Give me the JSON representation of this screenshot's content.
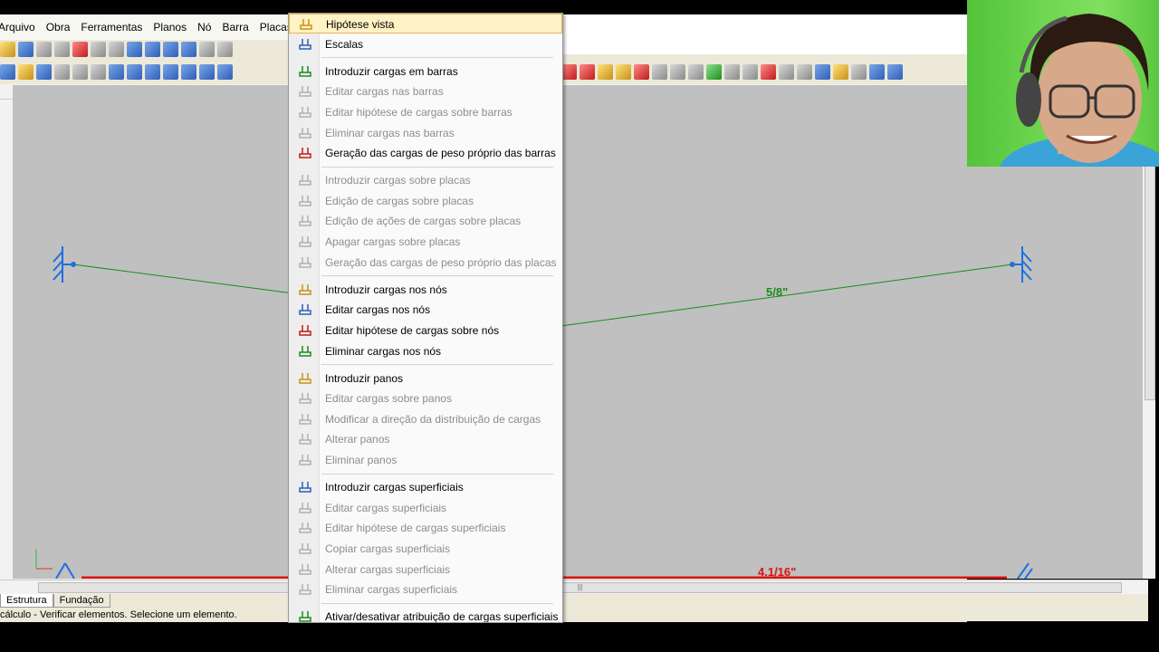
{
  "menubar": {
    "items": [
      "Arquivo",
      "Obra",
      "Ferramentas",
      "Planos",
      "Nó",
      "Barra",
      "Placas"
    ]
  },
  "canvas": {
    "labels": {
      "top_bar": "5/8\"",
      "bottom_bar": "4.1/16\""
    }
  },
  "tabs": [
    "Estrutura",
    "Fundação"
  ],
  "status": "cálculo - Verificar elementos.  Selecione um elemento.",
  "colors": {
    "top_bar": "#1a8c1a",
    "bottom_bar": "#e01010",
    "support": "#1e6fe0",
    "highlight": "#fff2c4"
  },
  "menu": {
    "items": [
      {
        "label": "Hipótese vista",
        "enabled": true,
        "highlighted": true,
        "icon": "hypothesis-icon"
      },
      {
        "label": "Escalas",
        "enabled": true,
        "icon": "scale-icon"
      },
      {
        "sep": true
      },
      {
        "label": "Introduzir cargas em barras",
        "enabled": true,
        "icon": "bar-load-add-icon"
      },
      {
        "label": "Editar cargas nas barras",
        "enabled": false,
        "icon": "bar-load-edit-icon"
      },
      {
        "label": "Editar hipótese de cargas sobre barras",
        "enabled": false,
        "icon": "bar-hypothesis-icon"
      },
      {
        "label": "Eliminar cargas nas barras",
        "enabled": false,
        "icon": "bar-load-delete-icon"
      },
      {
        "label": "Geração das cargas de peso próprio das barras",
        "enabled": true,
        "icon": "self-weight-icon"
      },
      {
        "sep": true
      },
      {
        "label": "Introduzir cargas sobre placas",
        "enabled": false,
        "icon": "plate-load-add-icon"
      },
      {
        "label": "Edição de cargas sobre placas",
        "enabled": false,
        "icon": "plate-load-edit-icon"
      },
      {
        "label": "Edição de ações de cargas sobre placas",
        "enabled": false,
        "icon": "plate-action-icon"
      },
      {
        "label": "Apagar cargas sobre placas",
        "enabled": false,
        "icon": "plate-load-delete-icon"
      },
      {
        "label": "Geração das cargas de peso próprio das placas",
        "enabled": false,
        "icon": "plate-weight-icon"
      },
      {
        "sep": true
      },
      {
        "label": "Introduzir cargas nos nós",
        "enabled": true,
        "icon": "node-load-add-icon"
      },
      {
        "label": "Editar cargas nos nós",
        "enabled": true,
        "icon": "node-load-edit-icon"
      },
      {
        "label": "Editar hipótese de cargas sobre nós",
        "enabled": true,
        "icon": "node-hypothesis-icon"
      },
      {
        "label": "Eliminar cargas nos nós",
        "enabled": true,
        "icon": "node-load-delete-icon"
      },
      {
        "sep": true
      },
      {
        "label": "Introduzir panos",
        "enabled": true,
        "icon": "panel-add-icon"
      },
      {
        "label": "Editar cargas sobre panos",
        "enabled": false,
        "icon": "panel-edit-icon"
      },
      {
        "label": "Modificar a direção da distribuição de cargas",
        "enabled": false,
        "icon": "panel-direction-icon"
      },
      {
        "label": "Alterar panos",
        "enabled": false,
        "icon": "panel-modify-icon"
      },
      {
        "label": "Eliminar panos",
        "enabled": false,
        "icon": "panel-delete-icon"
      },
      {
        "sep": true
      },
      {
        "label": "Introduzir cargas superficiais",
        "enabled": true,
        "icon": "surface-load-add-icon"
      },
      {
        "label": "Editar cargas superficiais",
        "enabled": false,
        "icon": "surface-load-edit-icon"
      },
      {
        "label": "Editar hipótese de cargas superficiais",
        "enabled": false,
        "icon": "surface-hypothesis-icon"
      },
      {
        "label": "Copiar cargas superficiais",
        "enabled": false,
        "icon": "surface-copy-icon"
      },
      {
        "label": "Alterar cargas superficiais",
        "enabled": false,
        "icon": "surface-modify-icon"
      },
      {
        "label": "Eliminar cargas superficiais",
        "enabled": false,
        "icon": "surface-delete-icon"
      },
      {
        "sep": true
      },
      {
        "label": "Ativar/desativar atribuição de cargas superficiais",
        "enabled": true,
        "icon": "surface-toggle-icon"
      }
    ]
  }
}
